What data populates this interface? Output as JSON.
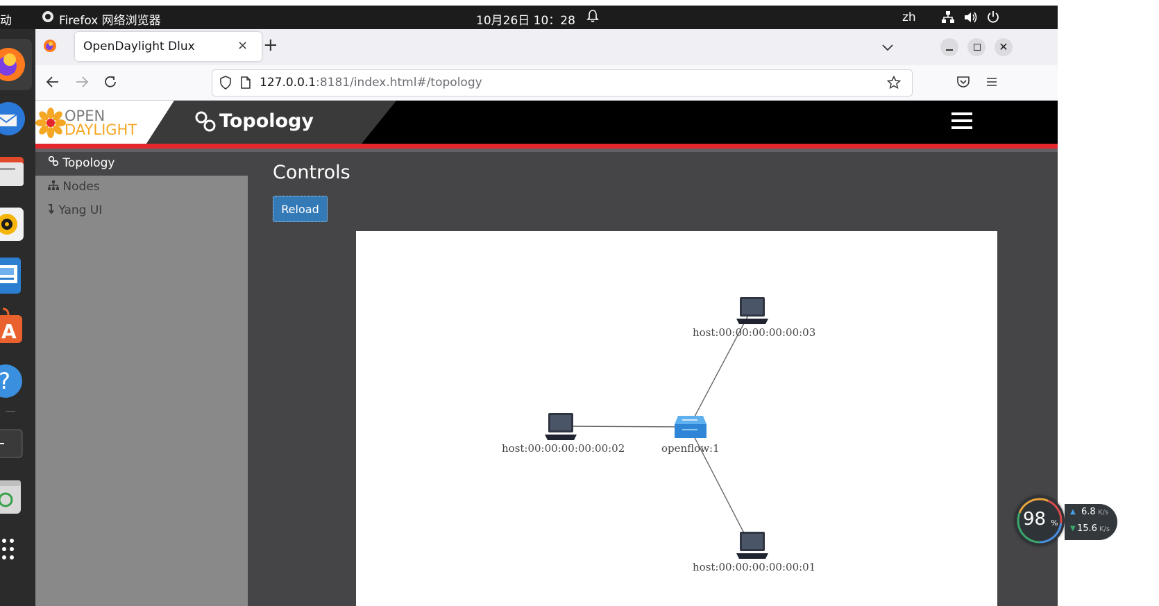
{
  "system_bar": {
    "activities_label": "动",
    "app_label": "Firefox 网络浏览器",
    "datetime": "10月26日 10：28",
    "language": "zh"
  },
  "browser": {
    "tab_title": "OpenDaylight Dlux",
    "url_host": "127.0.0.1",
    "url_rest": ":8181/index.html#/topology"
  },
  "app": {
    "logo_line1": "OPEN",
    "logo_line2": "DAYLIGHT",
    "header_title": "Topology",
    "sidebar": [
      {
        "label": "Topology"
      },
      {
        "label": "Nodes"
      },
      {
        "label": "Yang UI"
      }
    ],
    "section_title": "Controls",
    "reload_label": "Reload"
  },
  "topology": {
    "nodes": [
      {
        "id": "host:00:00:00:00:00:03",
        "type": "host"
      },
      {
        "id": "host:00:00:00:00:00:02",
        "type": "host"
      },
      {
        "id": "openflow:1",
        "type": "switch"
      },
      {
        "id": "host:00:00:00:00:00:01",
        "type": "host"
      }
    ],
    "links": [
      [
        "openflow:1",
        "host:00:00:00:00:00:03"
      ],
      [
        "openflow:1",
        "host:00:00:00:00:00:02"
      ],
      [
        "openflow:1",
        "host:00:00:00:00:00:01"
      ]
    ]
  },
  "net_widget": {
    "cpu_percent": "98",
    "cpu_unit": "%",
    "upload": "6.8",
    "download": "15.6",
    "rate_unit": "K/s"
  },
  "colors": {
    "header_bg": "#000000",
    "accent_red": "#e3272d",
    "content_bg": "#454547",
    "sidebar_bg": "#898989",
    "button_blue": "#337ab7",
    "switch_blue": "#2f86d6"
  }
}
